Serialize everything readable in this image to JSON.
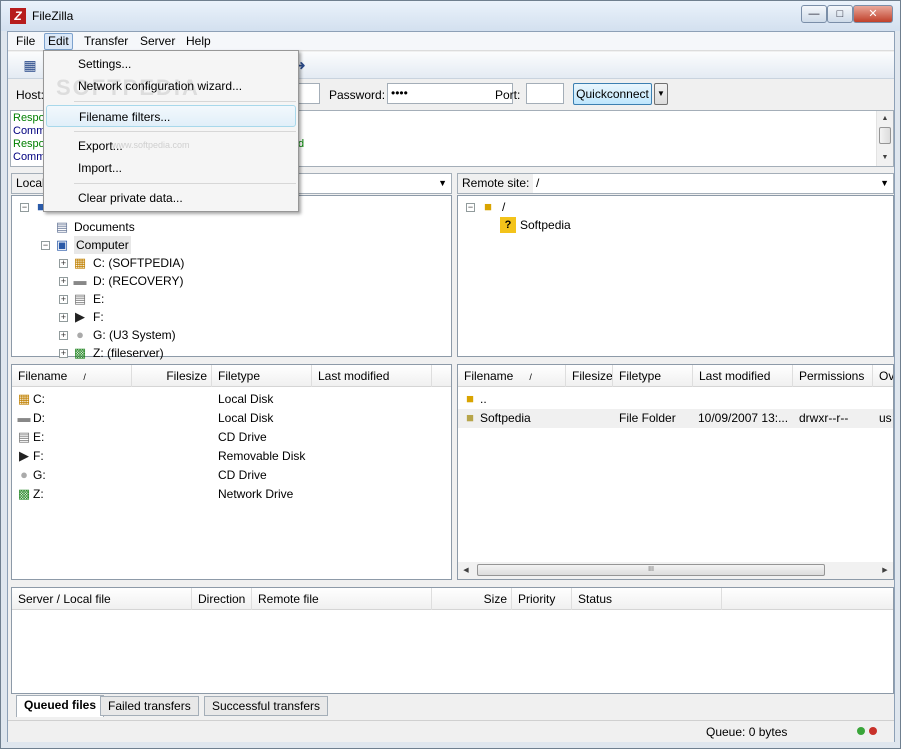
{
  "window": {
    "title": "FileZilla"
  },
  "menubar": {
    "items": [
      "File",
      "Edit",
      "Transfer",
      "Server",
      "Help"
    ]
  },
  "quickconnect": {
    "host_label": "Host:",
    "password_label": "Password:",
    "password_value": "••••",
    "port_label": "Port:",
    "port_value": "",
    "connect_label": "Quickconnect"
  },
  "log": {
    "lines": [
      {
        "text": "Respo",
        "color": "#007f00"
      },
      {
        "text": "Comm",
        "color": "#00007f"
      },
      {
        "text": "Respo",
        "color": "#007f00"
      },
      {
        "text": "Comm",
        "color": "#00007f"
      }
    ],
    "fragment": "d"
  },
  "edit_menu": {
    "items": [
      "Settings...",
      "Network configuration wizard...",
      "Filename filters...",
      "Export...",
      "Import...",
      "Clear private data..."
    ],
    "highlighted": "Filename filters..."
  },
  "watermark": {
    "text": "SOFTPEDIA",
    "sub": "www.softpedia.com"
  },
  "local": {
    "site_label": "Local",
    "tree": [
      {
        "label": "Documents",
        "icon": "documents-icon"
      },
      {
        "label": "Computer",
        "icon": "computer-icon"
      },
      {
        "label": "C: (SOFTPEDIA)",
        "icon": "windows-drive-icon"
      },
      {
        "label": "D: (RECOVERY)",
        "icon": "hard-drive-icon"
      },
      {
        "label": "E:",
        "icon": "cd-drive-icon"
      },
      {
        "label": "F:",
        "icon": "removable-disk-icon"
      },
      {
        "label": "G: (U3 System)",
        "icon": "cd-drive-icon"
      },
      {
        "label": "Z: (fileserver)",
        "icon": "network-drive-icon"
      }
    ],
    "columns": [
      "Filename",
      "Filesize",
      "Filetype",
      "Last modified"
    ],
    "sort_indicator": "/",
    "files": [
      {
        "name": "C:",
        "type": "Local Disk",
        "icon": "windows-drive-icon"
      },
      {
        "name": "D:",
        "type": "Local Disk",
        "icon": "hard-drive-icon"
      },
      {
        "name": "E:",
        "type": "CD Drive",
        "icon": "cd-drive-icon"
      },
      {
        "name": "F:",
        "type": "Removable Disk",
        "icon": "removable-disk-icon"
      },
      {
        "name": "G:",
        "type": "CD Drive",
        "icon": "cd-drive-icon"
      },
      {
        "name": "Z:",
        "type": "Network Drive",
        "icon": "network-drive-icon"
      }
    ]
  },
  "remote": {
    "site_label": "Remote site:",
    "site_value": "/",
    "tree": [
      {
        "label": "/",
        "icon": "folder-icon"
      },
      {
        "label": "Softpedia",
        "icon": "unknown-folder-icon"
      }
    ],
    "columns": [
      "Filename",
      "Filesize",
      "Filetype",
      "Last modified",
      "Permissions",
      "Ov"
    ],
    "sort_indicator": "/",
    "files": [
      {
        "name": "..",
        "type": "",
        "modified": "",
        "permissions": "",
        "owner": ""
      },
      {
        "name": "Softpedia",
        "type": "File Folder",
        "modified": "10/09/2007 13:...",
        "permissions": "drwxr--r--",
        "owner": "us"
      }
    ],
    "scroll_grip": "III"
  },
  "queue": {
    "columns": [
      "Server / Local file",
      "Direction",
      "Remote file",
      "Size",
      "Priority",
      "Status"
    ],
    "tabs": [
      "Queued files",
      "Failed transfers",
      "Successful transfers"
    ],
    "active_tab": "Queued files"
  },
  "status": {
    "queue_text": "Queue: 0 bytes"
  }
}
